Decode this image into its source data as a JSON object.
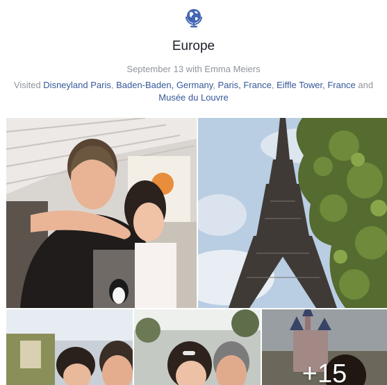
{
  "album": {
    "icon": "globe-icon",
    "title": "Europe",
    "date_with": "September 13 with Emma Meiers",
    "visited_prefix": "Visited ",
    "places": [
      {
        "label": "Disneyland Paris",
        "sep": ", "
      },
      {
        "label": "Baden-Baden, Germany",
        "sep": ", "
      },
      {
        "label": "Paris, France",
        "sep": ", "
      },
      {
        "label": "Eiffle Tower, France",
        "sep": " and "
      },
      {
        "label": "Musée du Louvre",
        "sep": ""
      }
    ],
    "accent_color": "#4267b2"
  },
  "photos": {
    "items": [
      {
        "name": "selfie-man-and-girl-photo"
      },
      {
        "name": "eiffel-tower-photo"
      },
      {
        "name": "restaurant-selfie-photo"
      },
      {
        "name": "outdoor-selfie-photo"
      },
      {
        "name": "castle-photo"
      }
    ],
    "more_count": "+15"
  }
}
